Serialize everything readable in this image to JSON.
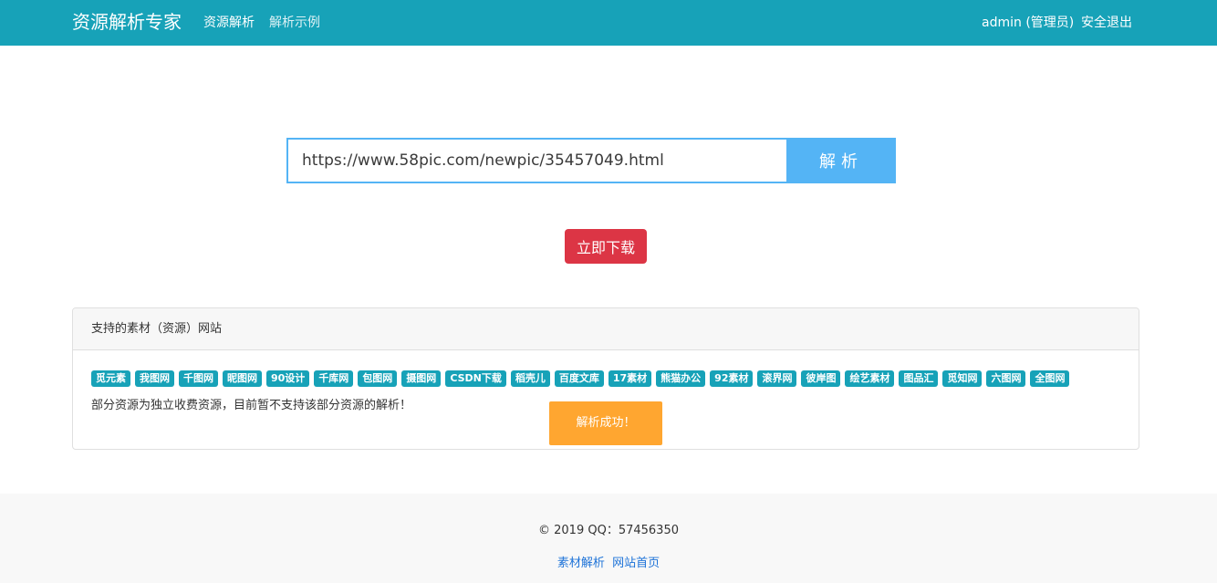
{
  "navbar": {
    "brand": "资源解析专家",
    "links": [
      "资源解析",
      "解析示例"
    ],
    "user": "admin (管理员)",
    "logout": "安全退出"
  },
  "search": {
    "value": "https://www.58pic.com/newpic/35457049.html",
    "button": "解析"
  },
  "download_button": "立即下载",
  "supported": {
    "title": "支持的素材（资源）网站",
    "sites": [
      "觅元素",
      "我图网",
      "千图网",
      "昵图网",
      "90设计",
      "千库网",
      "包图网",
      "摄图网",
      "CSDN下载",
      "稻壳儿",
      "百度文库",
      "17素材",
      "熊猫办公",
      "92素材",
      "滚界网",
      "彼岸图",
      "绘艺素材",
      "图品汇",
      "觅知网",
      "六图网",
      "全图网"
    ],
    "note": "部分资源为独立收费资源，目前暂不支持该部分资源的解析！"
  },
  "toast": "解析成功！",
  "footer": {
    "copyright": "© 2019 QQ：57456350",
    "links": [
      "素材解析",
      "网站首页"
    ]
  },
  "colors": {
    "navbar": "#17a2b8",
    "search_button": "#54b4f5",
    "download_button": "#dc3545",
    "tag": "#17a2b8",
    "toast": "#ffa630",
    "link": "#1e73d8"
  }
}
